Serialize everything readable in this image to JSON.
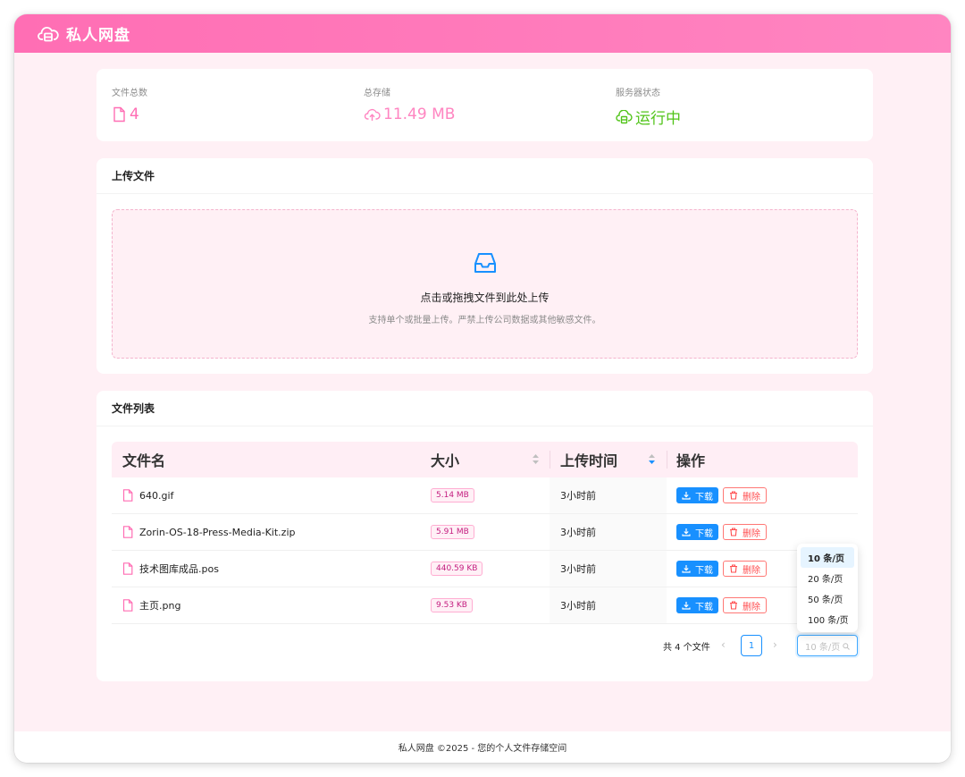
{
  "header": {
    "title": "私人网盘"
  },
  "stats": [
    {
      "label": "文件总数",
      "value": "4",
      "color": "#ff6eb4",
      "icon": "file-icon"
    },
    {
      "label": "总存储",
      "value": "11.49 MB",
      "color": "#ff85c1",
      "icon": "cloud-upload-icon"
    },
    {
      "label": "服务器状态",
      "value": "运行中",
      "color": "#52c41a",
      "icon": "cloud-server-icon"
    }
  ],
  "upload": {
    "title": "上传文件",
    "main_text": "点击或拖拽文件到此处上传",
    "hint": "支持单个或批量上传。严禁上传公司数据或其他敏感文件。"
  },
  "file_list": {
    "title": "文件列表",
    "columns": {
      "name": "文件名",
      "size": "大小",
      "time": "上传时间",
      "ops": "操作"
    },
    "rows": [
      {
        "name": "640.gif",
        "size": "5.14 MB",
        "time": "3小时前"
      },
      {
        "name": "Zorin-OS-18-Press-Media-Kit.zip",
        "size": "5.91 MB",
        "time": "3小时前"
      },
      {
        "name": "技术图库成品.pos",
        "size": "440.59 KB",
        "time": "3小时前"
      },
      {
        "name": "主页.png",
        "size": "9.53 KB",
        "time": "3小时前"
      }
    ],
    "download_label": "下载",
    "delete_label": "删除"
  },
  "pagination": {
    "total": "共 4 个文件",
    "current_page": "1",
    "page_size_placeholder": "10 条/页",
    "options": [
      "10 条/页",
      "20 条/页",
      "50 条/页",
      "100 条/页"
    ],
    "selected_option": 0
  },
  "footer": {
    "text": "私人网盘 ©2025 - 您的个人文件存储空间"
  },
  "colors": {
    "accent_pink": "#ff6eb4",
    "primary_blue": "#1890ff",
    "danger_red": "#ff4d4f",
    "success_green": "#52c41a"
  }
}
